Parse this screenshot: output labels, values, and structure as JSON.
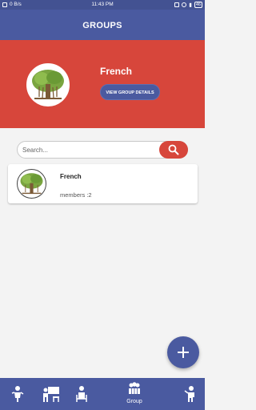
{
  "status_bar": {
    "speed": "0 B/s",
    "time": "11:43 PM",
    "battery": "46"
  },
  "app_bar": {
    "title": "GROUPS"
  },
  "hero": {
    "group_name": "French",
    "details_button": "VIEW GROUP DETAILS"
  },
  "search": {
    "placeholder": "Search..."
  },
  "groups": [
    {
      "name": "French",
      "members": "members :2"
    }
  ],
  "bottom_nav": {
    "items": [
      {
        "icon": "student-icon"
      },
      {
        "icon": "classroom-icon"
      },
      {
        "icon": "teacher-icon"
      },
      {
        "icon": "group-icon",
        "label": "Group"
      },
      {
        "icon": "person-icon"
      }
    ]
  },
  "colors": {
    "primary": "#4a5aa0",
    "accent": "#d7463b"
  }
}
